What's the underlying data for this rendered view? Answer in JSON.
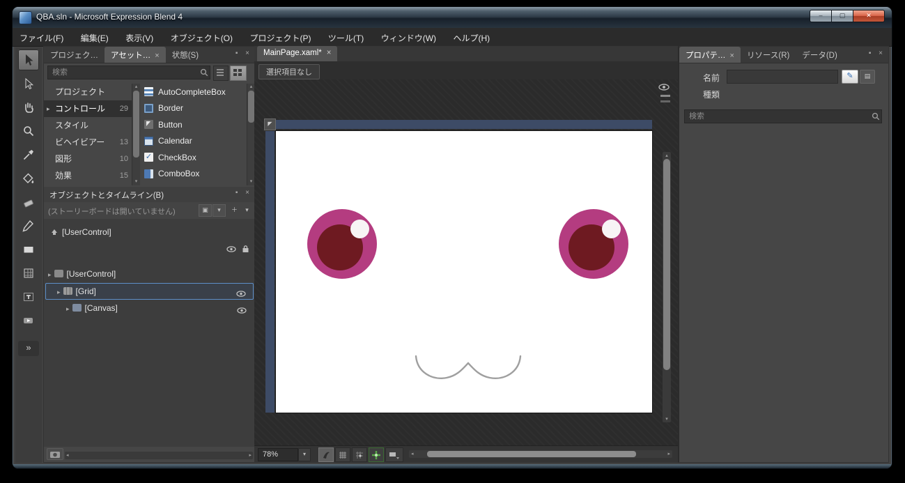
{
  "window": {
    "title": "QBA.sln - Microsoft Expression Blend 4"
  },
  "glyphs": {
    "minimize": "–",
    "maximize": "▢",
    "close": "✕",
    "tab_close": "×",
    "pin_and_close": "▪ ×",
    "chevron_down": "▾",
    "chevron_right": "▸",
    "chevron_left": "◂",
    "chevron_up": "▴",
    "double_chevron": "»",
    "check": "✓",
    "edit_pencil": "✎",
    "small_grid": "▤",
    "storyboard_picker": "▣",
    "corner_adorner": "◤"
  },
  "menu": {
    "items": [
      "ファイル(F)",
      "編集(E)",
      "表示(V)",
      "オブジェクト(O)",
      "プロジェクト(P)",
      "ツール(T)",
      "ウィンドウ(W)",
      "ヘルプ(H)"
    ]
  },
  "toolbox": {
    "tools": [
      "selection",
      "direct-selection",
      "pan",
      "zoom",
      "eyedropper",
      "paint-bucket",
      "eraser",
      "pen",
      "rectangle",
      "layout-grid",
      "text",
      "common-controls",
      "assets"
    ]
  },
  "left_panel": {
    "tabs": [
      {
        "label": "プロジェク…"
      },
      {
        "label": "アセット…",
        "active": true
      },
      {
        "label": "状態(S)"
      }
    ],
    "search": {
      "placeholder": "検索"
    },
    "categories": [
      {
        "label": "プロジェクト",
        "count": ""
      },
      {
        "label": "コントロール",
        "count": "29"
      },
      {
        "label": "スタイル",
        "count": ""
      },
      {
        "label": "ビヘイビアー",
        "count": "13"
      },
      {
        "label": "図形",
        "count": "10"
      },
      {
        "label": "効果",
        "count": "15"
      }
    ],
    "assets": [
      "AutoCompleteBox",
      "Border",
      "Button",
      "Calendar",
      "CheckBox",
      "ComboBox"
    ]
  },
  "objects_panel": {
    "title": "オブジェクトとタイムライン(B)",
    "storyboard_status": "(ストーリーボードは開いていません)",
    "tree": {
      "root": "[UserControl]",
      "items": [
        {
          "label": "[UserControl]"
        },
        {
          "label": "[Grid]",
          "selected": true
        },
        {
          "label": "[Canvas]"
        }
      ]
    }
  },
  "document": {
    "tab_label": "MainPage.xaml*",
    "breadcrumb": "選択項目なし"
  },
  "statusbar": {
    "zoom_level": "78%"
  },
  "right_panel": {
    "tabs": [
      {
        "label": "プロパテ…",
        "active": true
      },
      {
        "label": "リソース(R)"
      },
      {
        "label": "データ(D)"
      }
    ],
    "name_label": "名前",
    "type_label": "種類",
    "search": {
      "placeholder": "検索"
    }
  },
  "colors": {
    "eye_outer": "#b43c80",
    "eye_pupil": "#6e1a21",
    "eye_highlight": "#f7f4f5",
    "mouth_stroke": "#9f9f9f",
    "selection_accent": "#5d8fc9",
    "snap_green": "#57a746",
    "artboard_rail": "#3d4b66"
  }
}
